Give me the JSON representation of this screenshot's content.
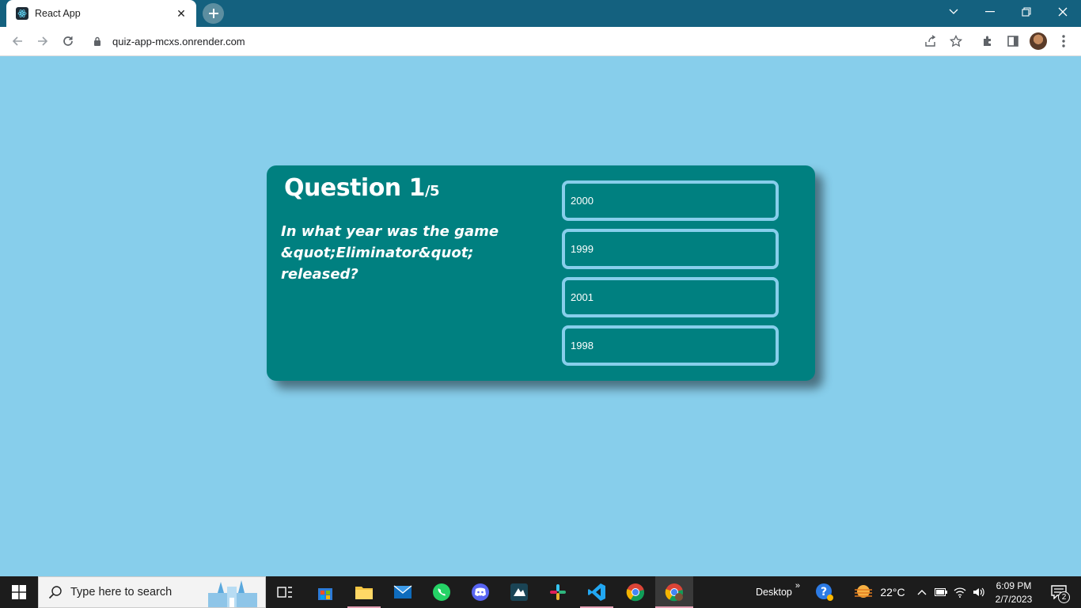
{
  "browser": {
    "tab_title": "React App",
    "url": "quiz-app-mcxs.onrender.com"
  },
  "quiz": {
    "question_label": "Question 1",
    "question_total": "/5",
    "question_text": "In what year was the game &quot;Eliminator&quot; released?",
    "answers": [
      "2000",
      "1999",
      "2001",
      "1998"
    ]
  },
  "taskbar": {
    "search_placeholder": "Type here to search",
    "desktop_label": "Desktop",
    "temperature": "22°C",
    "time": "6:09 PM",
    "date": "2/7/2023",
    "notification_count": "2"
  },
  "colors": {
    "page_background": "#87ceeb",
    "card_background": "#008080",
    "answer_border": "#87ceeb",
    "titlebar": "#14617f"
  }
}
